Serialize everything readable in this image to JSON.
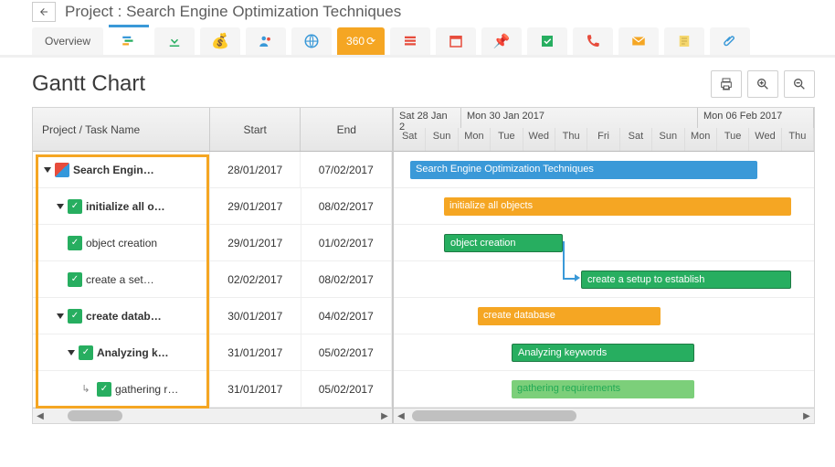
{
  "header": {
    "prefix": "Project :",
    "project_name": "Search Engine Optimization Techniques"
  },
  "tabs": {
    "overview": "Overview",
    "deg360": "360"
  },
  "title": "Gantt Chart",
  "grid_headers": {
    "name": "Project / Task Name",
    "start": "Start",
    "end": "End"
  },
  "timeline_headers": {
    "span1": "Sat 28 Jan 2",
    "span2": "Mon 30 Jan 2017",
    "span3": "Mon 06 Feb 2017",
    "days": [
      "Sat",
      "Sun",
      "Mon",
      "Tue",
      "Wed",
      "Thu",
      "Fri",
      "Sat",
      "Sun",
      "Mon",
      "Tue",
      "Wed",
      "Thu"
    ]
  },
  "rows": [
    {
      "label": "Search Engin…",
      "start": "28/01/2017",
      "end": "07/02/2017",
      "bar_label": "Search Engine Optimization Techniques"
    },
    {
      "label": "initialize all o…",
      "start": "29/01/2017",
      "end": "08/02/2017",
      "bar_label": "initialize all objects"
    },
    {
      "label": "object creation",
      "start": "29/01/2017",
      "end": "01/02/2017",
      "bar_label": "object creation"
    },
    {
      "label": "create a set…",
      "start": "02/02/2017",
      "end": "08/02/2017",
      "bar_label": "create a setup to establish"
    },
    {
      "label": "create datab…",
      "start": "30/01/2017",
      "end": "04/02/2017",
      "bar_label": "create database"
    },
    {
      "label": "Analyzing k…",
      "start": "31/01/2017",
      "end": "05/02/2017",
      "bar_label": "Analyzing keywords"
    },
    {
      "label": "gathering r…",
      "start": "31/01/2017",
      "end": "05/02/2017",
      "bar_label": "gathering requirements"
    }
  ],
  "chart_data": {
    "type": "gantt",
    "time_axis": {
      "start": "2017-01-28",
      "end": "2017-02-09",
      "unit": "day"
    },
    "tasks": [
      {
        "name": "Search Engine Optimization Techniques",
        "start": "2017-01-28",
        "end": "2017-02-07",
        "color": "#3a99d8",
        "level": 0
      },
      {
        "name": "initialize all objects",
        "start": "2017-01-29",
        "end": "2017-02-08",
        "color": "#f5a623",
        "level": 1
      },
      {
        "name": "object creation",
        "start": "2017-01-29",
        "end": "2017-02-01",
        "color": "#27ae60",
        "level": 2
      },
      {
        "name": "create a setup to establish",
        "start": "2017-02-02",
        "end": "2017-02-08",
        "color": "#27ae60",
        "level": 2,
        "depends_on": "object creation"
      },
      {
        "name": "create database",
        "start": "2017-01-30",
        "end": "2017-02-04",
        "color": "#f5a623",
        "level": 1
      },
      {
        "name": "Analyzing keywords",
        "start": "2017-01-31",
        "end": "2017-02-05",
        "color": "#27ae60",
        "level": 2
      },
      {
        "name": "gathering requirements",
        "start": "2017-01-31",
        "end": "2017-02-05",
        "color": "#7ccf7a",
        "level": 3
      }
    ]
  }
}
